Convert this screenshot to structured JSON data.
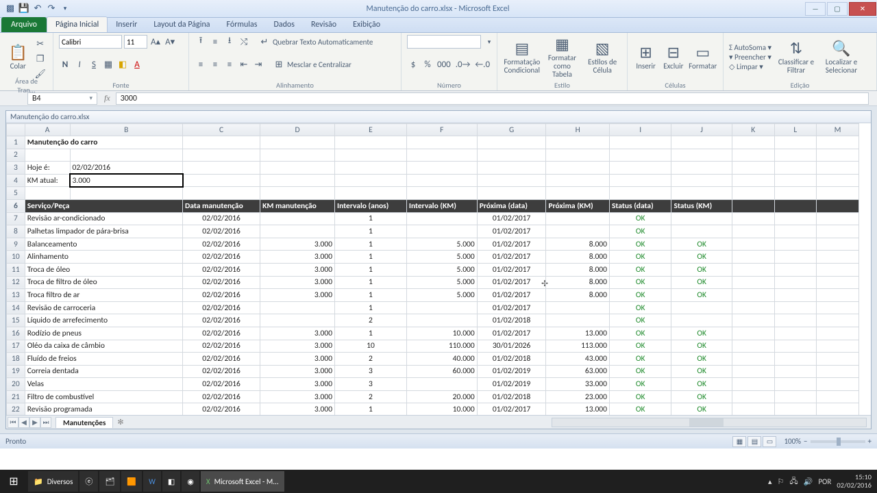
{
  "window": {
    "title": "Manutenção do carro.xlsx - Microsoft Excel",
    "doc_title": "Manutenção do carro.xlsx"
  },
  "tabs": {
    "file": "Arquivo",
    "list": [
      "Página Inicial",
      "Inserir",
      "Layout da Página",
      "Fórmulas",
      "Dados",
      "Revisão",
      "Exibição"
    ],
    "active": 0
  },
  "ribbon": {
    "clipboard": {
      "paste": "Colar",
      "label": "Área de Tran..."
    },
    "font": {
      "name": "Calibri",
      "size": "11",
      "label": "Fonte"
    },
    "align": {
      "wrap": "Quebrar Texto Automaticamente",
      "merge": "Mesclar e Centralizar",
      "label": "Alinhamento"
    },
    "number": {
      "format": "",
      "label": "Número"
    },
    "style": {
      "cond": "Formatação Condicional",
      "table": "Formatar como Tabela",
      "cell": "Estilos de Célula",
      "label": "Estilo"
    },
    "cells": {
      "insert": "Inserir",
      "delete": "Excluir",
      "format": "Formatar",
      "label": "Células"
    },
    "editing": {
      "sum": "AutoSoma",
      "fill": "Preencher",
      "clear": "Limpar",
      "sort": "Classificar e Filtrar",
      "find": "Localizar e Selecionar",
      "label": "Edição"
    }
  },
  "formula": {
    "cell": "B4",
    "value": "3000"
  },
  "sheet": {
    "columns": [
      "A",
      "B",
      "C",
      "D",
      "E",
      "F",
      "G",
      "H",
      "I",
      "J",
      "K",
      "L",
      "M"
    ],
    "colwidths": [
      "colA",
      "colB",
      "colC",
      "colD",
      "colE",
      "colF",
      "colG",
      "colH",
      "colI",
      "colJ",
      "colK",
      "colL",
      "colM"
    ],
    "title": "Manutenção do carro",
    "today_label": "Hoje é:",
    "today_value": "02/02/2016",
    "km_label": "KM atual:",
    "km_value": "3.000",
    "headers": [
      "Serviço/Peça",
      "Data manutenção",
      "KM manutenção",
      "Intervalo (anos)",
      "Intervalo (KM)",
      "Próxima (data)",
      "Próxima (KM)",
      "Status (data)",
      "Status (KM)"
    ],
    "rows": [
      {
        "n": 7,
        "svc": "Revisão ar-condicionado",
        "dm": "02/02/2016",
        "km": "",
        "ia": "1",
        "ik": "",
        "pd": "01/02/2017",
        "pk": "",
        "sd": "OK",
        "sk": ""
      },
      {
        "n": 8,
        "svc": "Palhetas limpador de pára-brisa",
        "dm": "02/02/2016",
        "km": "",
        "ia": "1",
        "ik": "",
        "pd": "01/02/2017",
        "pk": "",
        "sd": "OK",
        "sk": ""
      },
      {
        "n": 9,
        "svc": "Balanceamento",
        "dm": "02/02/2016",
        "km": "3.000",
        "ia": "1",
        "ik": "5.000",
        "pd": "01/02/2017",
        "pk": "8.000",
        "sd": "OK",
        "sk": "OK"
      },
      {
        "n": 10,
        "svc": "Alinhamento",
        "dm": "02/02/2016",
        "km": "3.000",
        "ia": "1",
        "ik": "5.000",
        "pd": "01/02/2017",
        "pk": "8.000",
        "sd": "OK",
        "sk": "OK"
      },
      {
        "n": 11,
        "svc": "Troca de óleo",
        "dm": "02/02/2016",
        "km": "3.000",
        "ia": "1",
        "ik": "5.000",
        "pd": "01/02/2017",
        "pk": "8.000",
        "sd": "OK",
        "sk": "OK"
      },
      {
        "n": 12,
        "svc": "Troca de filtro de óleo",
        "dm": "02/02/2016",
        "km": "3.000",
        "ia": "1",
        "ik": "5.000",
        "pd": "01/02/2017",
        "pk": "8.000",
        "sd": "OK",
        "sk": "OK"
      },
      {
        "n": 13,
        "svc": "Troca filtro de ar",
        "dm": "02/02/2016",
        "km": "3.000",
        "ia": "1",
        "ik": "5.000",
        "pd": "01/02/2017",
        "pk": "8.000",
        "sd": "OK",
        "sk": "OK"
      },
      {
        "n": 14,
        "svc": "Revisão de carroceria",
        "dm": "02/02/2016",
        "km": "",
        "ia": "1",
        "ik": "",
        "pd": "01/02/2017",
        "pk": "",
        "sd": "OK",
        "sk": ""
      },
      {
        "n": 15,
        "svc": "Líquido de arrefecimento",
        "dm": "02/02/2016",
        "km": "",
        "ia": "2",
        "ik": "",
        "pd": "01/02/2018",
        "pk": "",
        "sd": "OK",
        "sk": ""
      },
      {
        "n": 16,
        "svc": "Rodízio de pneus",
        "dm": "02/02/2016",
        "km": "3.000",
        "ia": "1",
        "ik": "10.000",
        "pd": "01/02/2017",
        "pk": "13.000",
        "sd": "OK",
        "sk": "OK"
      },
      {
        "n": 17,
        "svc": "Oléo da caixa de câmbio",
        "dm": "02/02/2016",
        "km": "3.000",
        "ia": "10",
        "ik": "110.000",
        "pd": "30/01/2026",
        "pk": "113.000",
        "sd": "OK",
        "sk": "OK"
      },
      {
        "n": 18,
        "svc": "Fluído de freios",
        "dm": "02/02/2016",
        "km": "3.000",
        "ia": "2",
        "ik": "40.000",
        "pd": "01/02/2018",
        "pk": "43.000",
        "sd": "OK",
        "sk": "OK"
      },
      {
        "n": 19,
        "svc": "Correia dentada",
        "dm": "02/02/2016",
        "km": "3.000",
        "ia": "3",
        "ik": "60.000",
        "pd": "01/02/2019",
        "pk": "63.000",
        "sd": "OK",
        "sk": "OK"
      },
      {
        "n": 20,
        "svc": "Velas",
        "dm": "02/02/2016",
        "km": "3.000",
        "ia": "3",
        "ik": "",
        "pd": "01/02/2019",
        "pk": "33.000",
        "sd": "OK",
        "sk": "OK"
      },
      {
        "n": 21,
        "svc": "Filtro de combustível",
        "dm": "02/02/2016",
        "km": "3.000",
        "ia": "2",
        "ik": "20.000",
        "pd": "01/02/2018",
        "pk": "23.000",
        "sd": "OK",
        "sk": "OK"
      },
      {
        "n": 22,
        "svc": "Revisão programada",
        "dm": "02/02/2016",
        "km": "3.000",
        "ia": "1",
        "ik": "10.000",
        "pd": "01/02/2017",
        "pk": "13.000",
        "sd": "OK",
        "sk": "OK"
      }
    ],
    "tab_name": "Manutenções"
  },
  "status": {
    "ready": "Pronto",
    "zoom": "100%"
  },
  "taskbar": {
    "folder": "Diversos",
    "excel": "Microsoft Excel - M...",
    "lang": "POR",
    "time": "15:10",
    "date": "02/02/2016"
  }
}
